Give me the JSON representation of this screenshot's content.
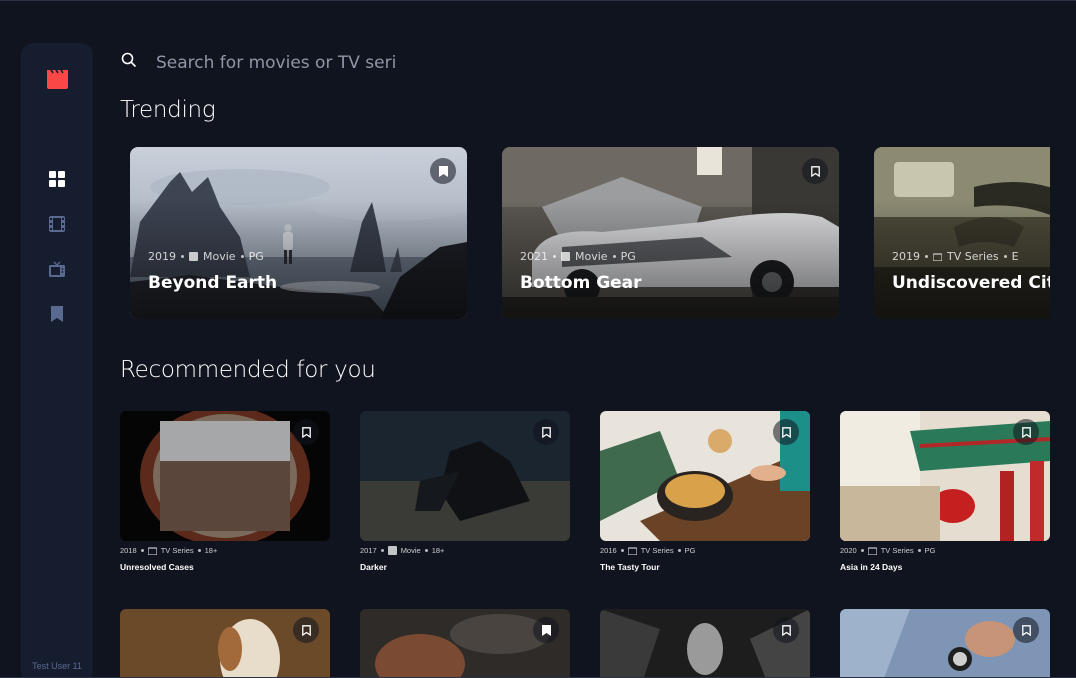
{
  "app": {
    "user_label": "Test User 11",
    "accent": "#fc4747"
  },
  "sidebar": {
    "items": [
      {
        "name": "home",
        "icon": "grid-icon",
        "active": true
      },
      {
        "name": "movies",
        "icon": "film-icon",
        "active": false
      },
      {
        "name": "tv-series",
        "icon": "tv-icon",
        "active": false
      },
      {
        "name": "bookmarks",
        "icon": "bookmark-icon",
        "active": false
      }
    ]
  },
  "search": {
    "placeholder": "Search for movies or TV series",
    "value": ""
  },
  "trending": {
    "title": "Trending",
    "items": [
      {
        "year": "2019",
        "category": "Movie",
        "rating": "PG",
        "title": "Beyond Earth"
      },
      {
        "year": "2021",
        "category": "Movie",
        "rating": "PG",
        "title": "Bottom Gear"
      },
      {
        "year": "2019",
        "category": "TV Series",
        "rating": "E",
        "title": "Undiscovered Cities"
      }
    ]
  },
  "recommended": {
    "title": "Recommended for you",
    "items": [
      {
        "year": "2018",
        "category": "TV Series",
        "rating": "18+",
        "title": "Unresolved Cases"
      },
      {
        "year": "2017",
        "category": "Movie",
        "rating": "18+",
        "title": "Darker"
      },
      {
        "year": "2016",
        "category": "TV Series",
        "rating": "PG",
        "title": "The Tasty Tour"
      },
      {
        "year": "2020",
        "category": "TV Series",
        "rating": "PG",
        "title": "Asia in 24 Days"
      }
    ]
  }
}
